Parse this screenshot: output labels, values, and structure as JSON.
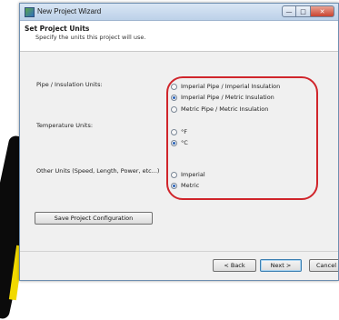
{
  "window": {
    "title": "New Project Wizard",
    "controls": {
      "minimize": "—",
      "maximize": "□",
      "close": "✕"
    }
  },
  "header": {
    "title": "Set Project Units",
    "subtitle": "Specify the units this project will use."
  },
  "groups": [
    {
      "label": "Pipe / Insulation Units:",
      "options": [
        {
          "label": "Imperial Pipe / Imperial Insulation",
          "selected": false
        },
        {
          "label": "Imperial Pipe / Metric Insulation",
          "selected": true
        },
        {
          "label": "Metric Pipe / Metric Insulation",
          "selected": false
        }
      ]
    },
    {
      "label": "Temperature Units:",
      "options": [
        {
          "label": "°F",
          "selected": false
        },
        {
          "label": "°C",
          "selected": true
        }
      ]
    },
    {
      "label": "Other Units (Speed, Length, Power, etc...)",
      "options": [
        {
          "label": "Imperial",
          "selected": false
        },
        {
          "label": "Metric",
          "selected": true
        }
      ]
    }
  ],
  "buttons": {
    "save": "Save Project Configuration",
    "back": "< Back",
    "next": "Next >",
    "cancel": "Cancel"
  },
  "colors": {
    "highlight": "#d0252b",
    "titlebar": "#bcd1e8",
    "radio_selected": "#2a63b8"
  }
}
